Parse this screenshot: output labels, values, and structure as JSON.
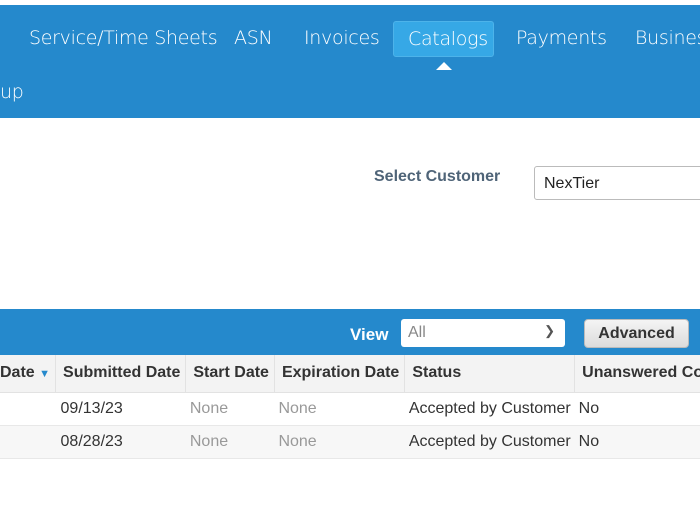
{
  "nav": {
    "items": [
      "Service/Time Sheets",
      "ASN",
      "Invoices",
      "Catalogs",
      "Payments",
      "Busines"
    ],
    "active": "Catalogs",
    "second_row": "up"
  },
  "customer": {
    "label": "Select Customer",
    "value": "NexTier"
  },
  "toolbar": {
    "view_label": "View",
    "view_value": "All",
    "advanced_label": "Advanced"
  },
  "table": {
    "headers": [
      "Date",
      "Submitted Date",
      "Start Date",
      "Expiration Date",
      "Status",
      "Unanswered Co"
    ],
    "rows": [
      [
        "",
        "09/13/23",
        "None",
        "None",
        "Accepted by Customer",
        "No"
      ],
      [
        "",
        "08/28/23",
        "None",
        "None",
        "Accepted by Customer",
        "No"
      ]
    ]
  }
}
